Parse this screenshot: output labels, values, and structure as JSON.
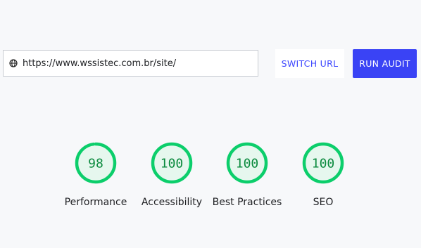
{
  "audit": {
    "url": "https://www.wssistec.com.br/site/",
    "switch_url_label": "SWITCH URL",
    "run_audit_label": "RUN AUDIT"
  },
  "scores": [
    {
      "value": 98,
      "label": "Performance",
      "color": "#0cce6b"
    },
    {
      "value": 100,
      "label": "Accessibility",
      "color": "#0cce6b"
    },
    {
      "value": 100,
      "label": "Best Practices",
      "color": "#0cce6b"
    },
    {
      "value": 100,
      "label": "SEO",
      "color": "#0cce6b"
    }
  ],
  "icons": {
    "url_icon": "globe-icon"
  }
}
